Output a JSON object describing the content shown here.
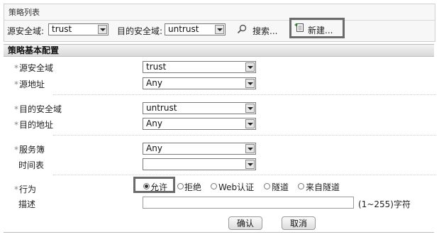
{
  "list_panel": {
    "title": "策略列表",
    "src_zone_label": "源安全域:",
    "src_zone_value": "trust",
    "dst_zone_label": "目的安全域:",
    "dst_zone_value": "untrust",
    "search_label": "搜索...",
    "new_label": "新建..."
  },
  "section": {
    "title": "策略基本配置"
  },
  "form": {
    "required_mark": "*",
    "src_zone_label": "源安全域",
    "src_zone_value": "trust",
    "src_addr_label": "源地址",
    "src_addr_value": "Any",
    "dst_zone_label": "目的安全域",
    "dst_zone_value": "untrust",
    "dst_addr_label": "目的地址",
    "dst_addr_value": "Any",
    "service_label": "服务簿",
    "service_value": "Any",
    "schedule_label": "时间表",
    "schedule_value": "",
    "action_label": "行为",
    "actions": [
      "允许",
      "拒绝",
      "Web认证",
      "隧道",
      "来自隧道"
    ],
    "desc_label": "描述",
    "desc_hint": "(1~255)字符"
  },
  "buttons": {
    "ok": "确认",
    "cancel": "取消"
  }
}
